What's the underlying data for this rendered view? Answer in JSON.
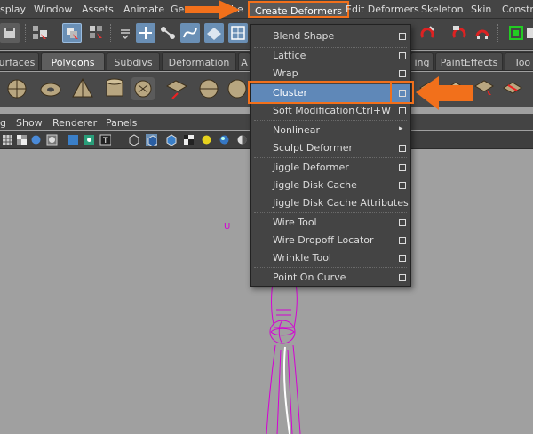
{
  "menubar": {
    "items": [
      {
        "label": "splay"
      },
      {
        "label": "Window"
      },
      {
        "label": "Assets"
      },
      {
        "label": "Animate"
      },
      {
        "label": "Geo"
      },
      {
        "label": "he"
      },
      {
        "label": "Create Deformers"
      },
      {
        "label": "Edit Deformers"
      },
      {
        "label": "Skeleton"
      },
      {
        "label": "Skin"
      },
      {
        "label": "Constra"
      }
    ]
  },
  "shelf_tabs": [
    {
      "label": "urfaces"
    },
    {
      "label": "Polygons"
    },
    {
      "label": "Subdivs"
    },
    {
      "label": "Deformation"
    },
    {
      "label": "A"
    },
    {
      "label": "ing"
    },
    {
      "label": "PaintEffects"
    },
    {
      "label": "Too"
    }
  ],
  "panel_menu": {
    "items": [
      {
        "label": "g"
      },
      {
        "label": "Show"
      },
      {
        "label": "Renderer"
      },
      {
        "label": "Panels"
      }
    ]
  },
  "dropdown": {
    "items": [
      {
        "label": "Blend Shape",
        "shortcut": "",
        "option": true
      },
      {
        "label": "Lattice",
        "shortcut": "",
        "option": true
      },
      {
        "label": "Wrap",
        "shortcut": "",
        "option": true
      },
      {
        "label": "Cluster",
        "shortcut": "",
        "option": true
      },
      {
        "label": "Soft Modification",
        "shortcut": "Ctrl+W",
        "option": true
      },
      {
        "label": "Nonlinear",
        "shortcut": "",
        "submenu": "▸"
      },
      {
        "label": "Sculpt Deformer",
        "shortcut": "",
        "option": true
      },
      {
        "label": "Jiggle Deformer",
        "shortcut": "",
        "option": true
      },
      {
        "label": "Jiggle Disk Cache",
        "shortcut": "",
        "option": true
      },
      {
        "label": "Jiggle Disk Cache Attributes",
        "shortcut": ""
      },
      {
        "label": "Wire Tool",
        "shortcut": "",
        "option": true
      },
      {
        "label": "Wire Dropoff Locator",
        "shortcut": "",
        "option": true
      },
      {
        "label": "Wrinkle Tool",
        "shortcut": "",
        "option": true
      },
      {
        "label": "Point On Curve",
        "shortcut": "",
        "option": true
      }
    ]
  },
  "viewport": {
    "marker_label": "U"
  },
  "colors": {
    "highlight": "#5f88b8",
    "callout": "#f2701b",
    "wireframe": "#d400d4"
  }
}
